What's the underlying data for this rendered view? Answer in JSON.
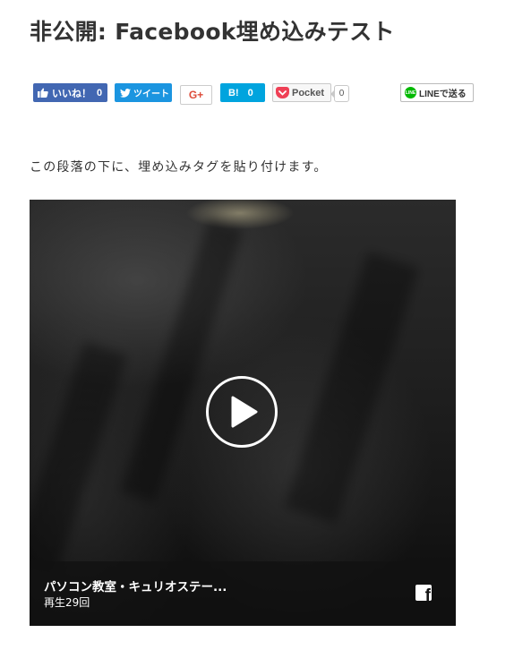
{
  "post": {
    "title": "非公開: Facebook埋め込みテスト",
    "paragraph": "この段落の下に、埋め込みタグを貼り付けます。"
  },
  "share": {
    "facebook": {
      "label": "いいね！",
      "count": "0",
      "icon": "thumbs-up-icon",
      "color": "#4267b2"
    },
    "twitter": {
      "label": "ツイート",
      "icon": "twitter-bird-icon",
      "color": "#1b95e0"
    },
    "google_plus": {
      "label": "G+",
      "color": "#dd4b39"
    },
    "hatena": {
      "label": "B!",
      "count": "0",
      "color": "#00a4de"
    },
    "pocket": {
      "label": "Pocket",
      "count": "0",
      "icon": "pocket-icon",
      "color": "#ef4056"
    },
    "line": {
      "label": "LINEで送る",
      "icon_text": "LINE",
      "color": "#00b900"
    }
  },
  "video": {
    "title": "パソコン教室・キュリオステー...",
    "views": "再生29回",
    "play_icon": "play-icon",
    "brand_icon": "facebook-f-icon"
  }
}
